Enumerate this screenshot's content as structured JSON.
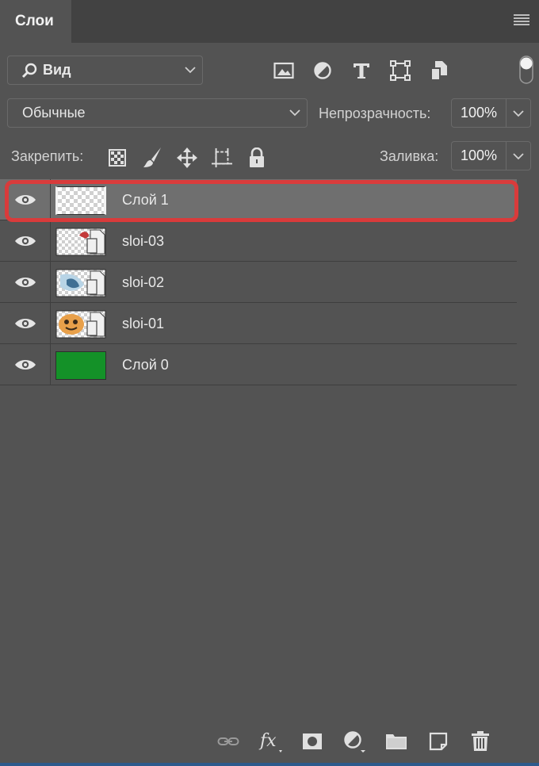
{
  "panel": {
    "tab_title": "Слои"
  },
  "filter": {
    "kind_label": "Вид",
    "icons": [
      "image-filter-icon",
      "adjustment-filter-icon",
      "type-filter-icon",
      "shape-filter-icon",
      "smart-object-filter-icon"
    ]
  },
  "blend": {
    "mode": "Обычные",
    "opacity_label": "Непрозрачность:",
    "opacity_value": "100%"
  },
  "lock": {
    "label": "Закрепить:",
    "fill_label": "Заливка:",
    "fill_value": "100%",
    "icons": [
      "lock-transparent-pixels-icon",
      "lock-image-pixels-icon",
      "lock-position-icon",
      "lock-artboard-icon",
      "lock-all-icon"
    ]
  },
  "layers": [
    {
      "name": "Слой 1",
      "selected": true,
      "thumb": "transparent"
    },
    {
      "name": "sloi-03",
      "selected": false,
      "thumb": "smart-object"
    },
    {
      "name": "sloi-02",
      "selected": false,
      "thumb": "smart-object"
    },
    {
      "name": "sloi-01",
      "selected": false,
      "thumb": "smart-object"
    },
    {
      "name": "Слой 0",
      "selected": false,
      "thumb": "solid-green"
    }
  ],
  "colors": {
    "panel_bg": "#535353",
    "selected_row": "#6f6f6f",
    "highlight": "#d93b3b",
    "green_layer": "#149128"
  },
  "footer_icons": [
    "link-layers-icon",
    "fx-icon",
    "layer-mask-icon",
    "adjustment-layer-icon",
    "group-folder-icon",
    "new-layer-icon",
    "trash-icon"
  ]
}
